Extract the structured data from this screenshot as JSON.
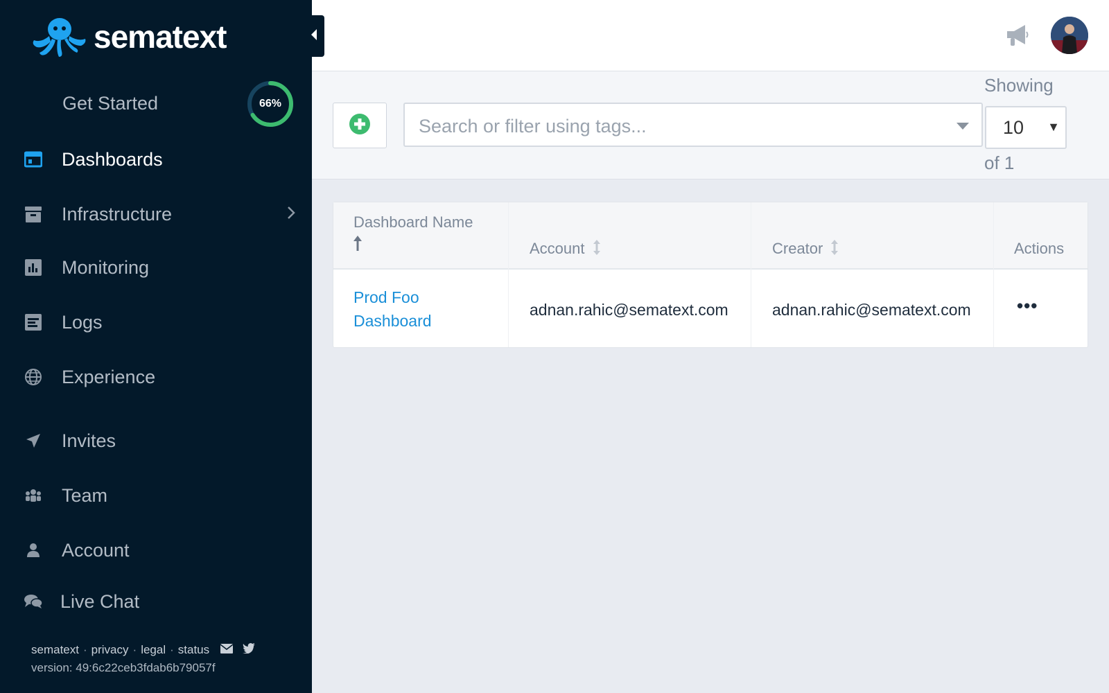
{
  "brand": {
    "name": "sematext"
  },
  "sidebar": {
    "get_started": {
      "label": "Get Started",
      "progress": 66,
      "progress_label": "66%"
    },
    "items": [
      {
        "label": "Dashboards",
        "icon": "dashboard-icon",
        "active": true
      },
      {
        "label": "Infrastructure",
        "icon": "infrastructure-icon",
        "has_submenu": true
      },
      {
        "label": "Monitoring",
        "icon": "monitoring-icon"
      },
      {
        "label": "Logs",
        "icon": "logs-icon"
      },
      {
        "label": "Experience",
        "icon": "globe-icon"
      },
      {
        "label": "Invites",
        "icon": "paper-plane-icon"
      },
      {
        "label": "Team",
        "icon": "team-icon"
      },
      {
        "label": "Account",
        "icon": "user-icon"
      },
      {
        "label": "Live Chat",
        "icon": "chat-icon"
      }
    ],
    "footer": {
      "links": [
        "sematext",
        "privacy",
        "legal",
        "status"
      ],
      "separator": "·",
      "version": "version: 49:6c22ceb3fdab6b79057f"
    }
  },
  "toolbar": {
    "search_placeholder": "Search or filter using tags...",
    "showing_label": "Showing",
    "page_size": "10",
    "of_pages": "of 1"
  },
  "table": {
    "columns": [
      "Dashboard Name",
      "Account",
      "Creator",
      "Actions"
    ],
    "rows": [
      {
        "name_line1": "Prod Foo",
        "name_line2": "Dashboard",
        "account": "adnan.rahic@sematext.com",
        "creator": "adnan.rahic@sematext.com",
        "actions": "•••"
      }
    ]
  },
  "colors": {
    "sidebar_bg": "#03192a",
    "accent": "#1a8fd8",
    "success": "#3dbb6f",
    "active_icon": "#1fa3f0"
  }
}
